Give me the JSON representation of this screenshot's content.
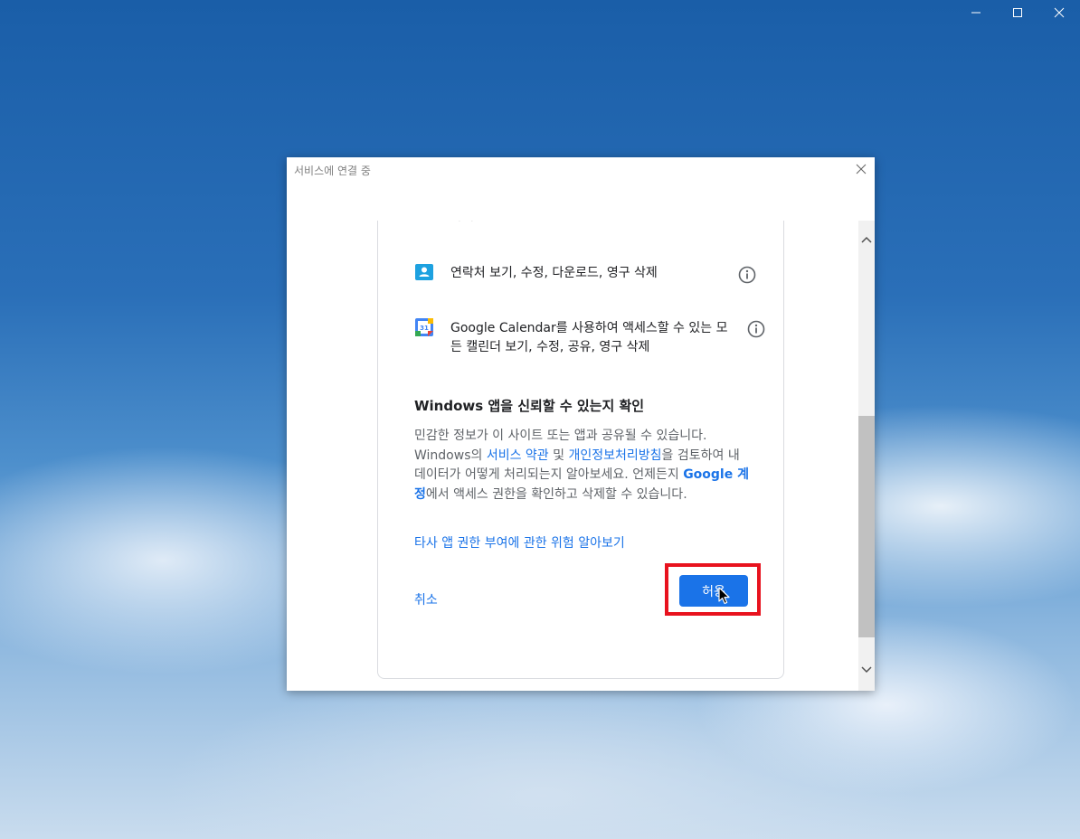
{
  "dialog": {
    "title": "서비스에 연결 중",
    "clipped_text": "삭제"
  },
  "permissions": [
    {
      "icon": "contacts-icon",
      "text": "연락처 보기, 수정, 다운로드, 영구 삭제"
    },
    {
      "icon": "google-calendar-icon",
      "text": "Google Calendar를 사용하여 액세스할 수 있는 모든 캘린더 보기, 수정, 공유, 영구 삭제",
      "icon_label": "31"
    }
  ],
  "trust": {
    "title": "Windows 앱을 신뢰할 수 있는지 확인",
    "body_1": "민감한 정보가 이 사이트 또는 앱과 공유될 수 있습니다. Windows의 ",
    "terms_link": "서비스 약관",
    "body_2": " 및 ",
    "privacy_link": "개인정보처리방침",
    "body_3": "을 검토하여 내 데이터가 어떻게 처리되는지 알아보세요. 언제든지 ",
    "account_link": "Google 계정",
    "body_4": "에서 액세스 권한을 확인하고 삭제할 수 있습니다.",
    "risk_link": "타사 앱 권한 부여에 관한 위험 알아보기"
  },
  "actions": {
    "cancel": "취소",
    "allow": "허용"
  },
  "colors": {
    "accent": "#1a73e8",
    "highlight": "#e8121e"
  }
}
